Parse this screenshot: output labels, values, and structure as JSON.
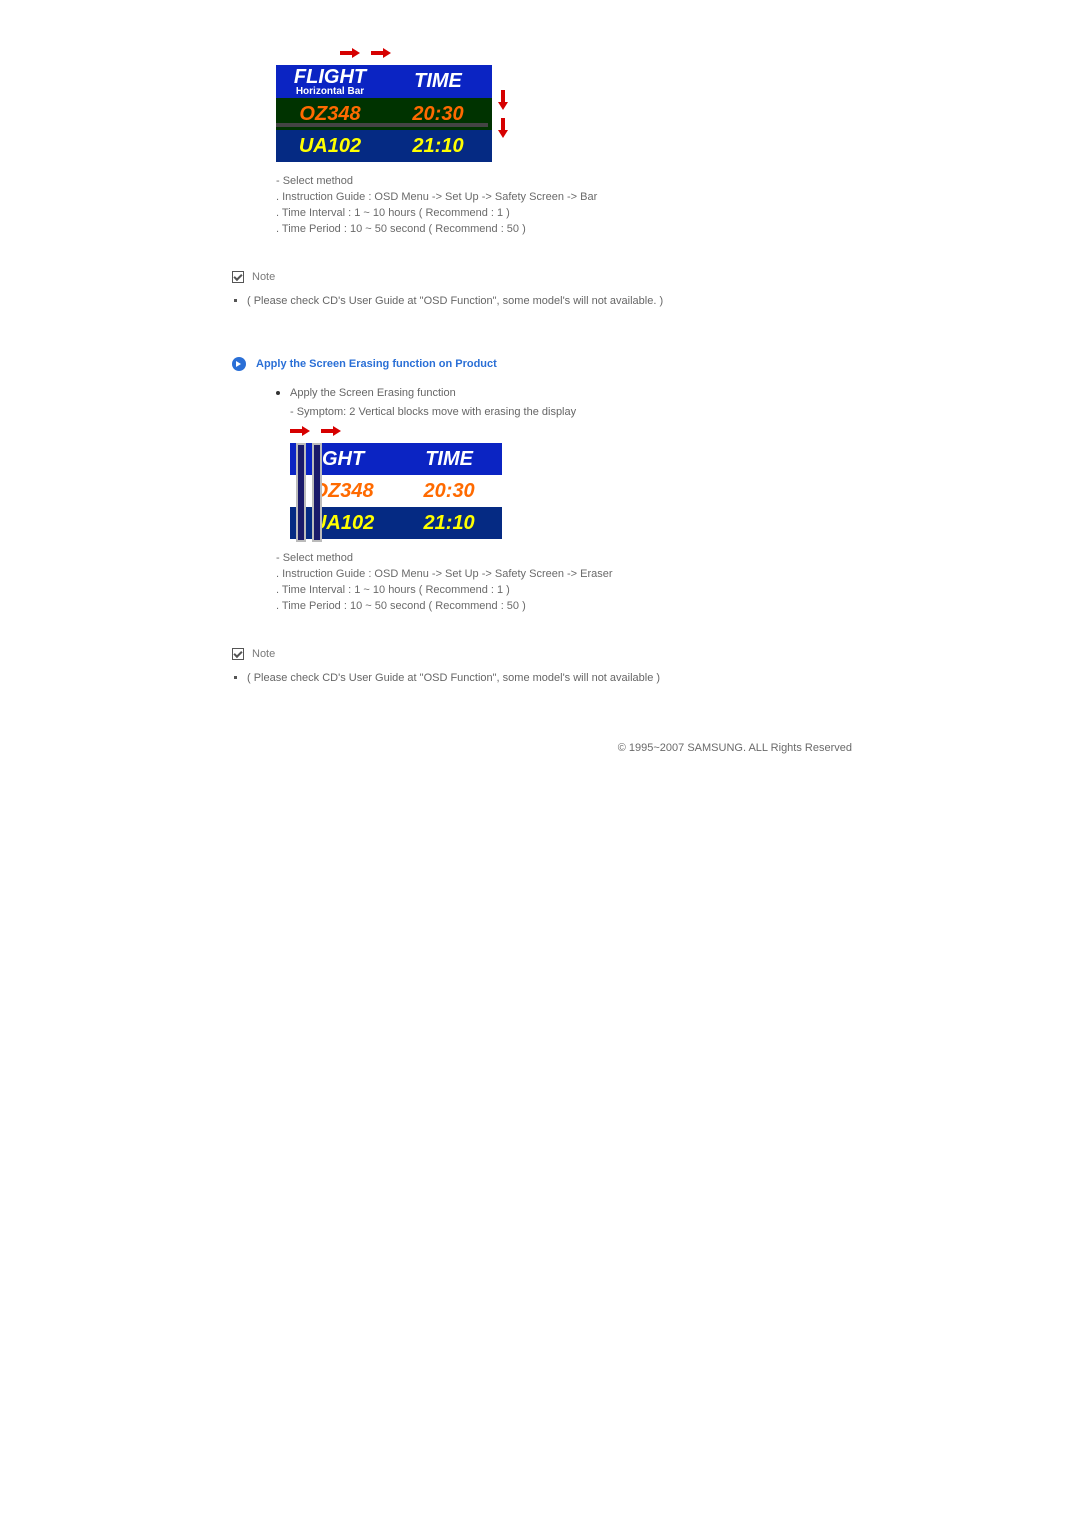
{
  "board1": {
    "h1": "FLIGHT",
    "h1_sub": "Horizontal Bar",
    "h2": "TIME",
    "r1c1": "OZ348",
    "r1c2": "20:30",
    "r2c1": "UA102",
    "r2c2": "21:10"
  },
  "sm1": {
    "line1": "- Select method",
    "line2": ". Instruction Guide : OSD Menu -> Set Up -> Safety Screen -> Bar",
    "line3": ". Time Interval : 1 ~ 10 hours ( Recommend : 1 )",
    "line4": ". Time Period : 10 ~ 50 second ( Recommend : 50 )"
  },
  "noteLabel": "Note",
  "note1": "( Please check CD's User Guide at \"OSD Function\", some model's will not available. )",
  "sectionTitle": "Apply the Screen Erasing function on Product",
  "subsec": {
    "line1": "Apply the Screen Erasing function",
    "line2": "- Symptom: 2 Vertical blocks move with erasing the display"
  },
  "board2": {
    "h1": "GHT",
    "h2": "TIME",
    "r1c1": "OZ348",
    "r1c2": "20:30",
    "r2c1": "UA102",
    "r2c2": "21:10"
  },
  "sm2": {
    "line1": "- Select method",
    "line2": ". Instruction Guide : OSD Menu -> Set Up -> Safety Screen -> Eraser",
    "line3": ". Time Interval : 1 ~ 10 hours ( Recommend : 1 )",
    "line4": ". Time Period : 10 ~ 50 second ( Recommend : 50 )"
  },
  "note2": "( Please check CD's User Guide at \"OSD Function\", some model's will not available )",
  "footer": "© 1995~2007 SAMSUNG. ALL Rights Reserved"
}
